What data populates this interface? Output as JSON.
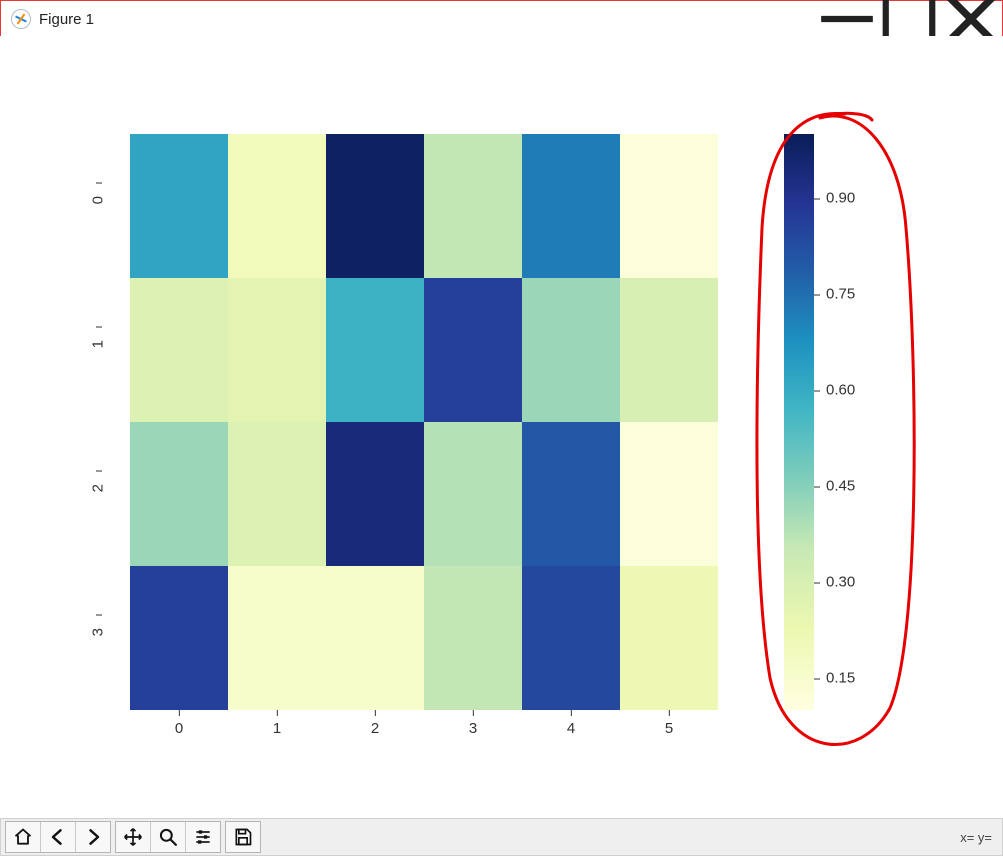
{
  "window": {
    "title": "Figure 1"
  },
  "status": {
    "coords_prefix": "x= y="
  },
  "chart_data": {
    "type": "heatmap",
    "rows": 4,
    "cols": 6,
    "x_categories": [
      "0",
      "1",
      "2",
      "3",
      "4",
      "5"
    ],
    "y_categories": [
      "0",
      "1",
      "2",
      "3"
    ],
    "values": [
      [
        0.62,
        0.2,
        0.98,
        0.36,
        0.72,
        0.12
      ],
      [
        0.28,
        0.26,
        0.58,
        0.86,
        0.42,
        0.3
      ],
      [
        0.42,
        0.28,
        0.94,
        0.38,
        0.8,
        0.12
      ],
      [
        0.86,
        0.16,
        0.16,
        0.36,
        0.84,
        0.22
      ]
    ],
    "colormap": "YlGnBu",
    "colorbar": {
      "ticks": [
        0.15,
        0.3,
        0.45,
        0.6,
        0.75,
        0.9
      ],
      "labels": [
        "0.15",
        "0.30",
        "0.45",
        "0.60",
        "0.75",
        "0.90"
      ],
      "range": [
        0.1,
        1.0
      ]
    },
    "xlabel": "",
    "ylabel": "",
    "title": ""
  }
}
